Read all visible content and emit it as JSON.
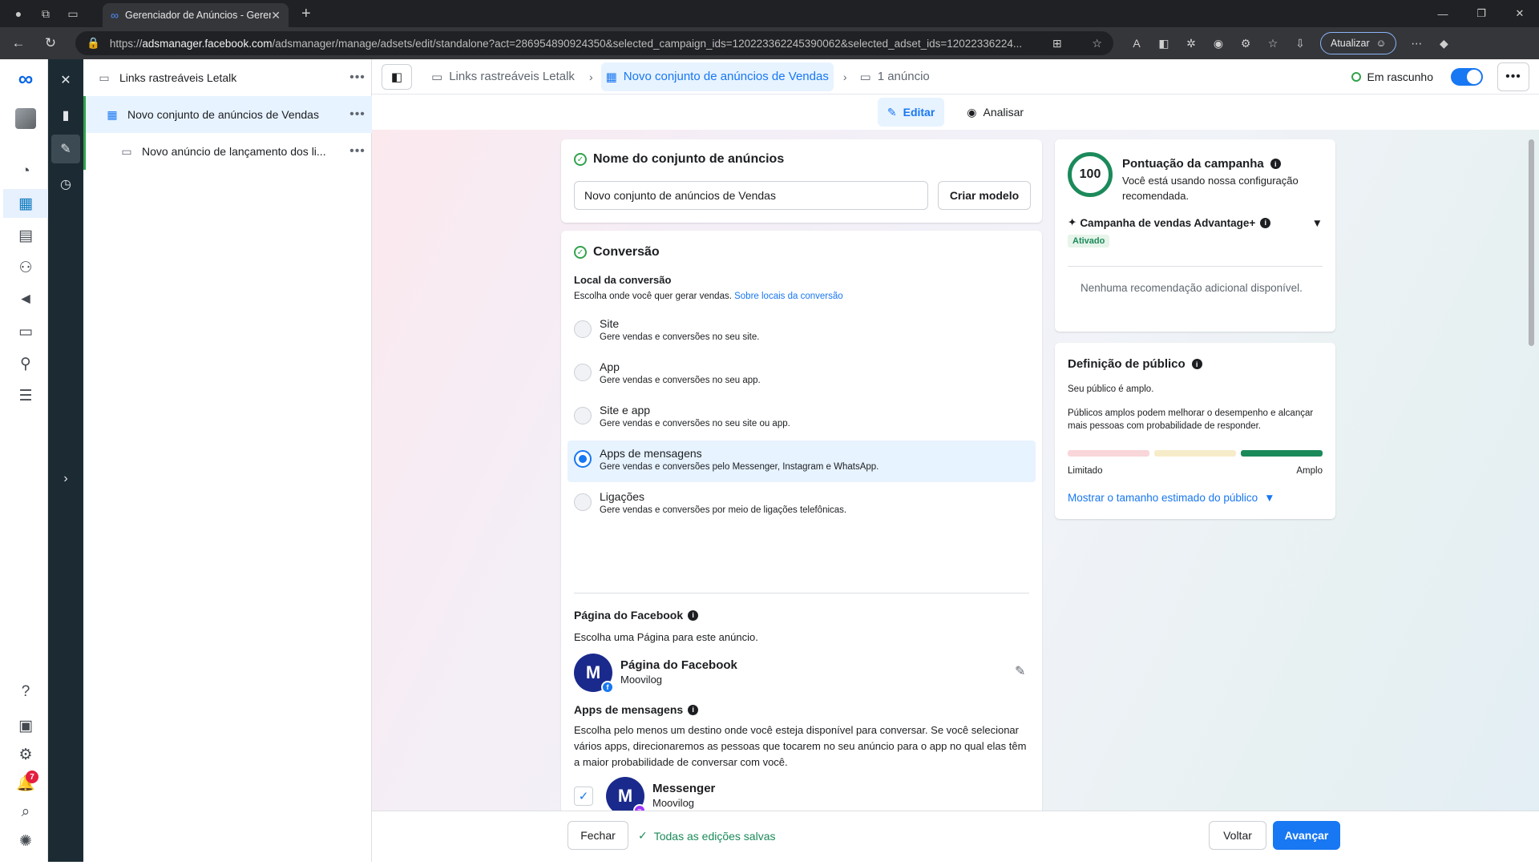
{
  "browser": {
    "tab_title": "Gerenciador de Anúncios - Geren",
    "url_host": "adsmanager.facebook.com",
    "url_prefix": "https://",
    "url_path": "/adsmanager/manage/adsets/edit/standalone?act=286954890924350&selected_campaign_ids=120223362245390062&selected_adset_ids=12022336224...",
    "update_label": "Atualizar"
  },
  "tree": {
    "campaign": "Links rastreáveis Letalk",
    "adset": "Novo conjunto de anúncios de Vendas",
    "ad": "Novo anúncio de lançamento dos li..."
  },
  "topbar": {
    "crumb_campaign": "Links rastreáveis Letalk",
    "crumb_adset": "Novo conjunto de anúncios de Vendas",
    "crumb_ads": "1 anúncio",
    "status": "Em rascunho"
  },
  "modes": {
    "edit": "Editar",
    "review": "Analisar"
  },
  "name_section": {
    "title": "Nome do conjunto de anúncios",
    "value": "Novo conjunto de anúncios de Vendas",
    "template_button": "Criar modelo"
  },
  "conversion": {
    "title": "Conversão",
    "location_title": "Local da conversão",
    "location_desc": "Escolha onde você quer gerar vendas.",
    "location_link": "Sobre locais da conversão",
    "options": [
      {
        "title": "Site",
        "desc": "Gere vendas e conversões no seu site."
      },
      {
        "title": "App",
        "desc": "Gere vendas e conversões no seu app."
      },
      {
        "title": "Site e app",
        "desc": "Gere vendas e conversões no seu site ou app."
      },
      {
        "title": "Apps de mensagens",
        "desc": "Gere vendas e conversões pelo Messenger, Instagram e WhatsApp."
      },
      {
        "title": "Ligações",
        "desc": "Gere vendas e conversões por meio de ligações telefônicas."
      }
    ],
    "selected_index": 3,
    "fb_page_title": "Página do Facebook",
    "fb_page_desc": "Escolha uma Página para este anúncio.",
    "fb_page_name": "Página do Facebook",
    "fb_page_sub": "Moovilog",
    "apps_title": "Apps de mensagens",
    "apps_desc": "Escolha pelo menos um destino onde você esteja disponível para conversar. Se você selecionar vários apps, direcionaremos as pessoas que tocarem no seu anúncio para o app no qual elas têm a maior probabilidade de conversar com você.",
    "messenger_name": "Messenger",
    "messenger_sub": "Moovilog",
    "avatar_letter": "M"
  },
  "score": {
    "value": "100",
    "title": "Pontuação da campanha",
    "desc": "Você está usando nossa configuração recomendada.",
    "advantage_title": "Campanha de vendas Advantage+",
    "advantage_status": "Ativado",
    "no_reco": "Nenhuma recomendação adicional disponível."
  },
  "audience": {
    "title": "Definição de público",
    "line1": "Seu público é amplo.",
    "line2": "Públicos amplos podem melhorar o desempenho e alcançar mais pessoas com probabilidade de responder.",
    "low": "Limitado",
    "high": "Amplo",
    "link": "Mostrar o tamanho estimado do público",
    "level": 0.85
  },
  "footer": {
    "close": "Fechar",
    "saved": "Todas as edições salvas",
    "back": "Voltar",
    "next": "Avançar"
  },
  "notifications": "7",
  "colors": {
    "accent": "#1877f2",
    "success": "#31a24c",
    "rail_dark": "#1c2b33"
  }
}
